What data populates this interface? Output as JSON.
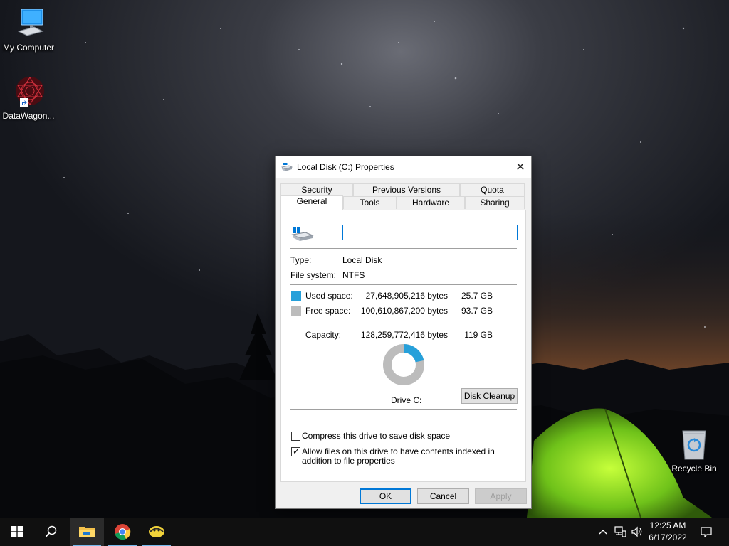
{
  "desktop": {
    "icons": [
      {
        "label": "My Computer",
        "icon": "computer-icon"
      },
      {
        "label": "DataWagon...",
        "icon": "datawagon-shortcut-icon"
      },
      {
        "label": "Recycle Bin",
        "icon": "recycle-bin-icon"
      }
    ]
  },
  "dialog": {
    "title": "Local Disk (C:) Properties",
    "tabs_row1": [
      "Security",
      "Previous Versions",
      "Quota"
    ],
    "tabs_row2": [
      "General",
      "Tools",
      "Hardware",
      "Sharing"
    ],
    "active_tab": "General",
    "drive_name_value": "",
    "type_label": "Type:",
    "type_value": "Local Disk",
    "fs_label": "File system:",
    "fs_value": "NTFS",
    "used_label": "Used space:",
    "used_bytes": "27,648,905,216 bytes",
    "used_gb": "25.7 GB",
    "free_label": "Free space:",
    "free_bytes": "100,610,867,200 bytes",
    "free_gb": "93.7 GB",
    "capacity_label": "Capacity:",
    "capacity_bytes": "128,259,772,416 bytes",
    "capacity_gb": "119 GB",
    "drive_label": "Drive C:",
    "disk_cleanup": "Disk Cleanup",
    "compress_label": "Compress this drive to save disk space",
    "compress_checked": false,
    "index_label": "Allow files on this drive to have contents indexed in addition to file properties",
    "index_checked": true,
    "ok": "OK",
    "cancel": "Cancel",
    "apply": "Apply",
    "colors": {
      "used": "#26a0da",
      "free": "#bcbcbc"
    },
    "usage_fraction": 0.2156
  },
  "taskbar": {
    "items": [
      "start-icon",
      "search-icon",
      "file-explorer-icon",
      "chrome-icon",
      "app-icon"
    ],
    "time": "12:25 AM",
    "date": "6/17/2022"
  }
}
